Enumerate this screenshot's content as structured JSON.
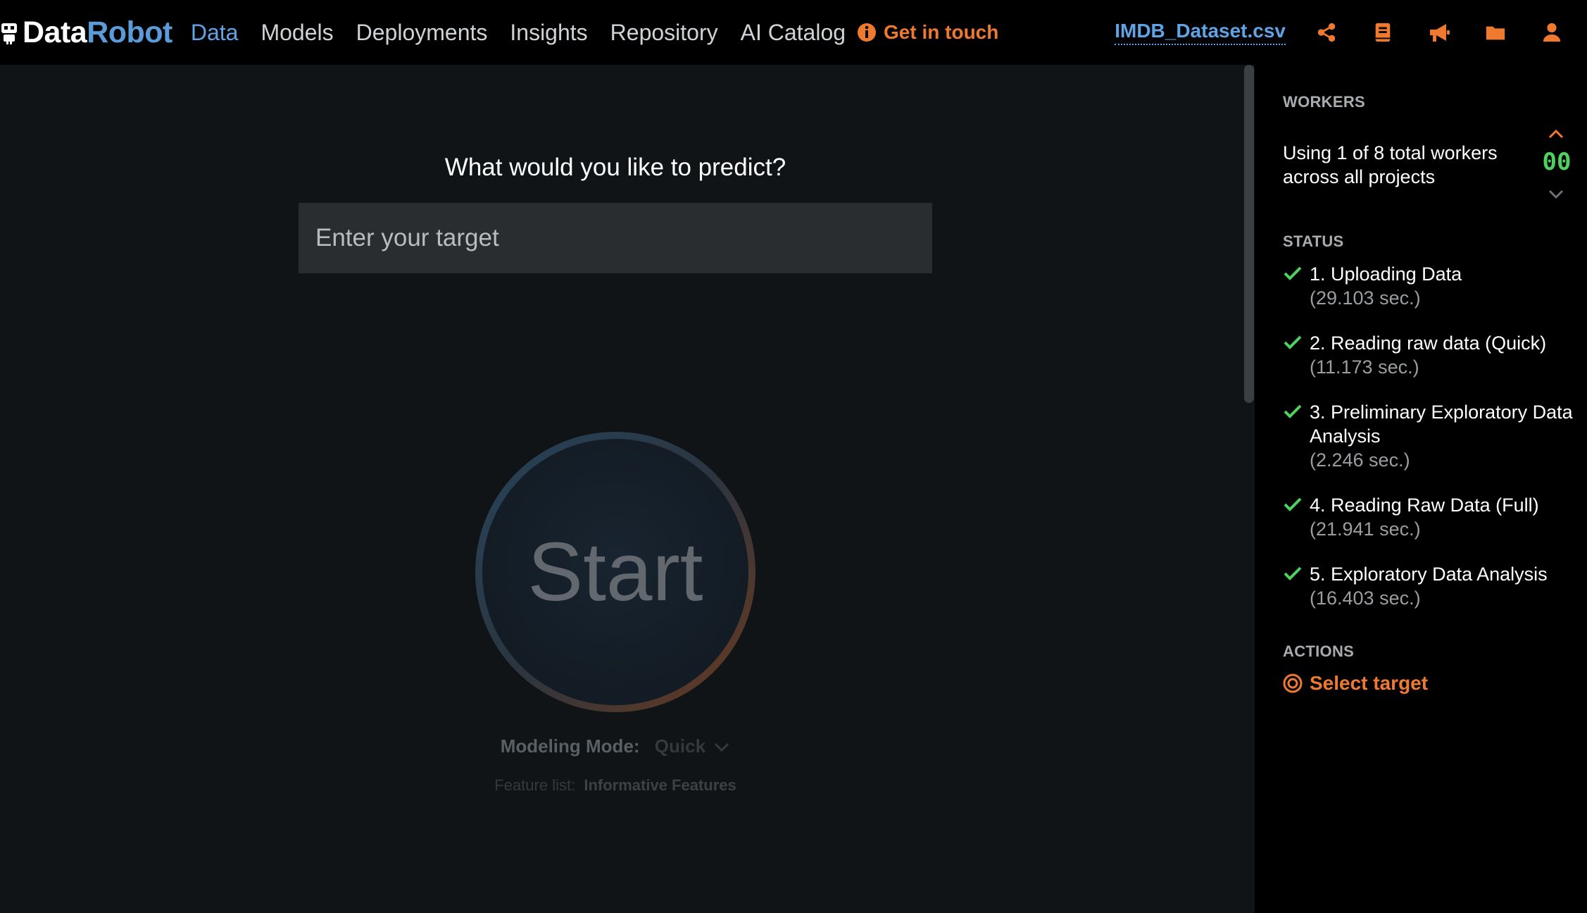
{
  "brand": {
    "part1": "Data",
    "part2": "Robot"
  },
  "nav": {
    "items": [
      "Data",
      "Models",
      "Deployments",
      "Insights",
      "Repository",
      "AI Catalog"
    ],
    "active": "Data",
    "get_in_touch": "Get in touch"
  },
  "header": {
    "dataset": "IMDB_Dataset.csv",
    "icons": [
      "share-icon",
      "book-icon",
      "megaphone-icon",
      "folder-icon",
      "user-icon"
    ]
  },
  "main": {
    "question": "What would you like to predict?",
    "target_placeholder": "Enter your target",
    "start_label": "Start",
    "modeling_mode_label": "Modeling Mode:",
    "modeling_mode_value": "Quick",
    "feature_list_label": "Feature list:",
    "feature_list_value": "Informative Features"
  },
  "sidebar": {
    "workers_title": "WORKERS",
    "workers_text": "Using 1 of 8 total workers across all projects",
    "worker_count": "00",
    "status_title": "STATUS",
    "status_items": [
      {
        "name": "1. Uploading Data",
        "time": "(29.103 sec.)"
      },
      {
        "name": "2. Reading raw data (Quick)",
        "time": "(11.173 sec.)"
      },
      {
        "name": "3. Preliminary Exploratory Data Analysis",
        "time": "(2.246 sec.)"
      },
      {
        "name": "4. Reading Raw Data (Full)",
        "time": "(21.941 sec.)"
      },
      {
        "name": "5. Exploratory Data Analysis",
        "time": "(16.403 sec.)"
      }
    ],
    "actions_title": "ACTIONS",
    "select_target": "Select target"
  },
  "colors": {
    "accent_orange": "#ef7a2f",
    "link_blue": "#5fa4e6",
    "check_green": "#4fd15f",
    "main_bg": "#111416"
  }
}
